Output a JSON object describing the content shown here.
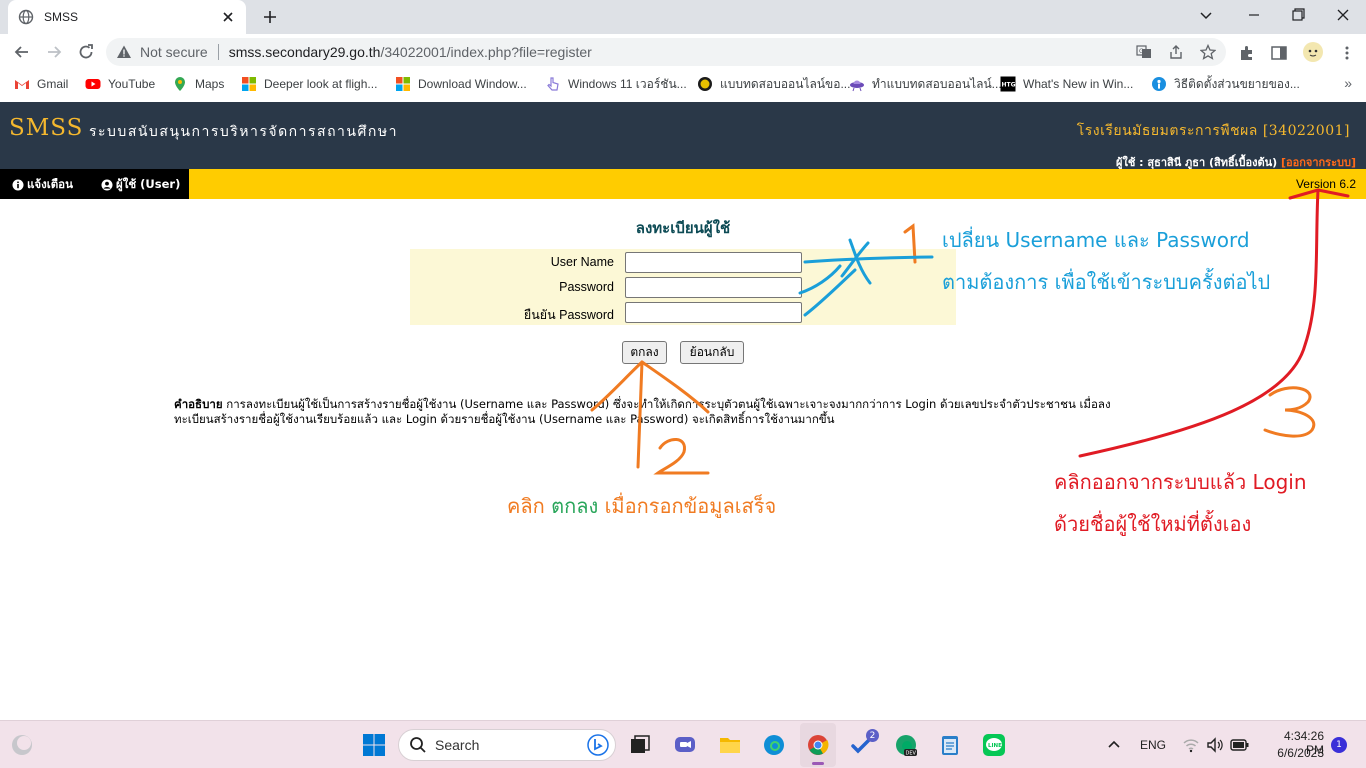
{
  "browser": {
    "tab_title": "SMSS",
    "address_warning": "Not secure",
    "url_domain": "smss.secondary29.go.th",
    "url_path": "/34022001/index.php?file=register",
    "bookmarks": [
      {
        "label": "Gmail",
        "icon": "gmail-icon",
        "color": "#ea4335"
      },
      {
        "label": "YouTube",
        "icon": "youtube-icon",
        "color": "#ff0000"
      },
      {
        "label": "Maps",
        "icon": "maps-icon",
        "color": "#34a853"
      },
      {
        "label": "Deeper look at fligh...",
        "icon": "windows-logo-icon",
        "color": "#f25022"
      },
      {
        "label": "Download Window...",
        "icon": "windows-logo-icon",
        "color": "#f25022"
      },
      {
        "label": "Windows 11 เวอร์ชัน...",
        "icon": "pointer-icon",
        "color": "#8a7bd8"
      },
      {
        "label": "แบบทดสอบออนไลน์ขอ...",
        "icon": "badge-icon",
        "color": "#c9a400"
      },
      {
        "label": "ทำแบบทดสอบออนไลน์...",
        "icon": "ufo-icon",
        "color": "#6b4bb8"
      },
      {
        "label": "What's New in Win...",
        "icon": "htg-icon",
        "color": "#000000"
      },
      {
        "label": "วิธีติดตั้งส่วนขยายของ...",
        "icon": "info-icon",
        "color": "#1a8fe0"
      }
    ]
  },
  "site": {
    "logo": "SMSS",
    "system_name": "ระบบสนับสนุนการบริหารจัดการสถานศึกษา",
    "school": "โรงเรียนมัธยมตระการพืชผล [34022001]",
    "user_prefix": "ผู้ใช้ : สุธาสินี ภูธา (สิทธิ์เบื้องต้น)",
    "logout": "[ออกจากระบบ]",
    "menu_alert": "แจ้งเตือน",
    "menu_user": "ผู้ใช้ (User)",
    "version": "Version 6.2"
  },
  "form": {
    "title": "ลงทะเบียนผู้ใช้",
    "username_label": "User Name",
    "password_label": "Password",
    "confirm_label": "ยืนยัน Password",
    "username_value": "",
    "password_value": "",
    "confirm_value": "",
    "submit_label": "ตกลง",
    "back_label": "ย้อนกลับ"
  },
  "description": {
    "heading": "คำอธิบาย",
    "line1": " การลงทะเบียนผู้ใช้เป็นการสร้างรายชื่อผู้ใช้งาน (Username และ Password) ซึ่งจะทำให้เกิดการระบุตัวตนผู้ใช้เฉพาะเจาะจงมากกว่าการ Login ด้วยเลขประจำตัวประชาชน เมื่อลง",
    "line2": "ทะเบียนสร้างรายชื่อผู้ใช้งานเรียบร้อยแล้ว และ Login ด้วยรายชื่อผู้ใช้งาน (Username และ Password) จะเกิดสิทธิ์การใช้งานมากขึ้น"
  },
  "annotations": {
    "step1_line1": "เปลี่ยน Username และ Password",
    "step1_line2": "ตามต้องการ เพื่อใช้เข้าระบบครั้งต่อไป",
    "step2_a": "คลิก ",
    "step2_b": "ตกลง",
    "step2_c": " เมื่อกรอกข้อมูลเสร็จ",
    "step3_line1": "คลิกออกจากระบบแล้ว Login",
    "step3_line2": "ด้วยชื่อผู้ใช้ใหม่ที่ตั้งเอง",
    "color_blue": "#1a9fd9",
    "color_red": "#e01b24",
    "color_orange": "#f07b22",
    "color_green": "#2aa65b"
  },
  "taskbar": {
    "search_placeholder": "Search",
    "lang": "ENG",
    "time": "4:34:26 PM",
    "date": "6/6/2023",
    "todo_badge": "2",
    "notif_badge": "1"
  }
}
